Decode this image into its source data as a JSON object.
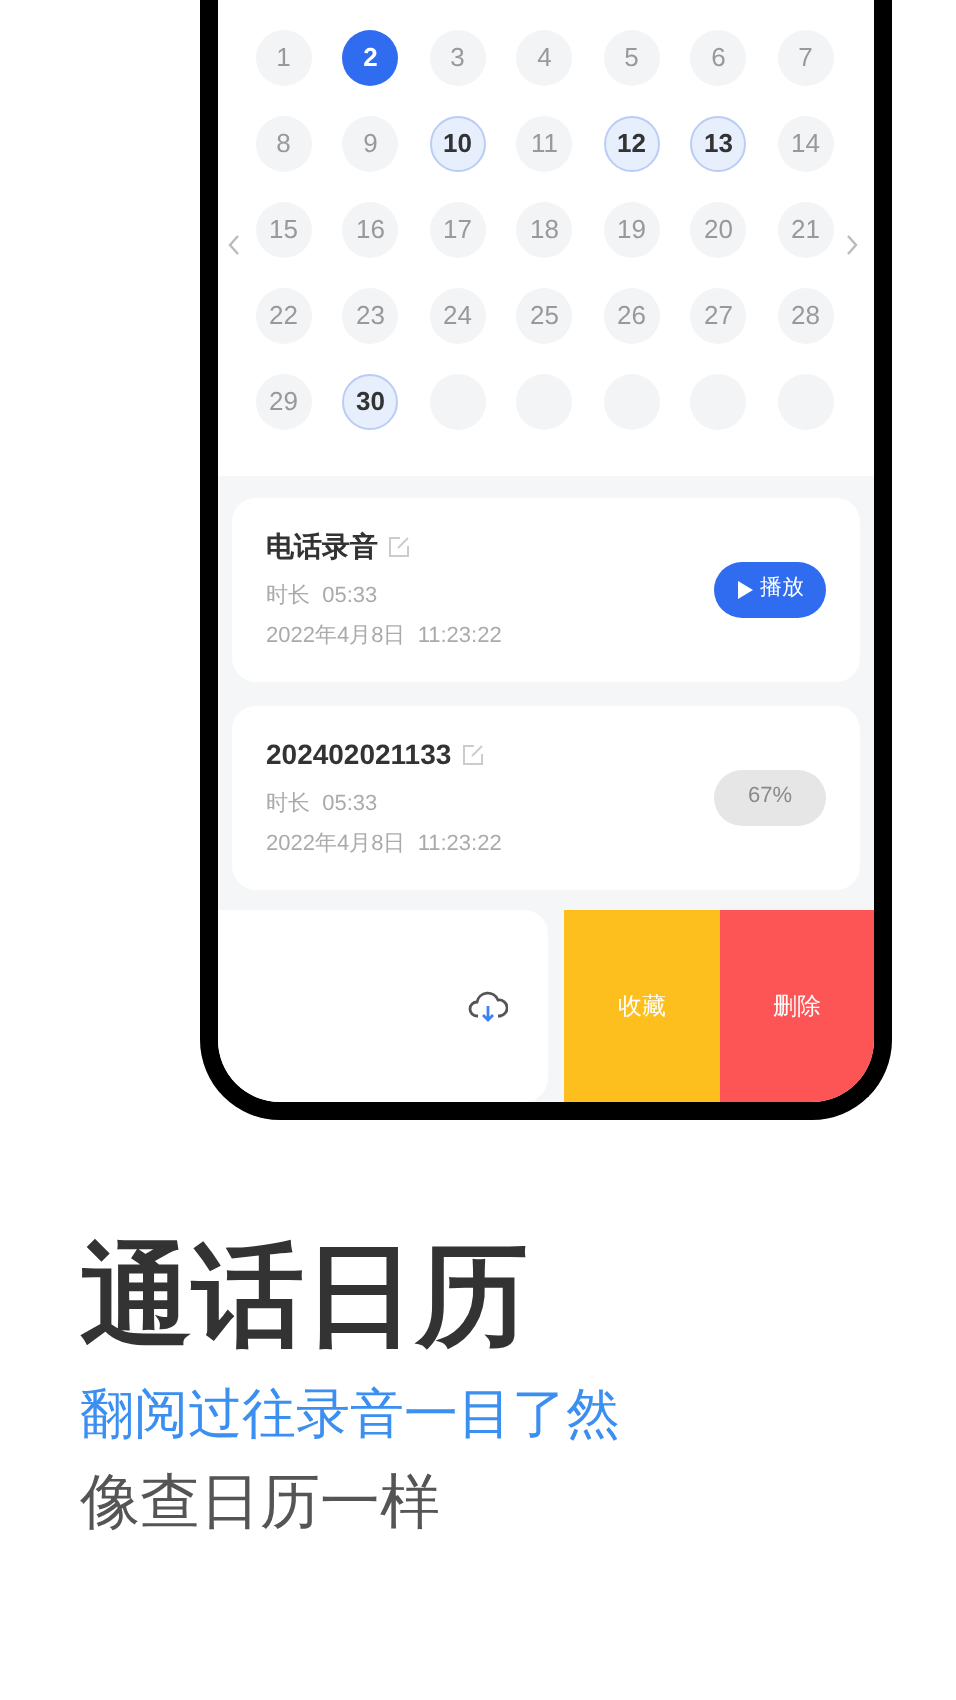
{
  "calendar": {
    "days": [
      {
        "label": "1",
        "kind": "day",
        "selected": false,
        "has_record": false
      },
      {
        "label": "2",
        "kind": "day",
        "selected": true,
        "has_record": false
      },
      {
        "label": "3",
        "kind": "day",
        "selected": false,
        "has_record": false
      },
      {
        "label": "4",
        "kind": "day",
        "selected": false,
        "has_record": false
      },
      {
        "label": "5",
        "kind": "day",
        "selected": false,
        "has_record": false
      },
      {
        "label": "6",
        "kind": "day",
        "selected": false,
        "has_record": false
      },
      {
        "label": "7",
        "kind": "day",
        "selected": false,
        "has_record": false
      },
      {
        "label": "8",
        "kind": "day",
        "selected": false,
        "has_record": false
      },
      {
        "label": "9",
        "kind": "day",
        "selected": false,
        "has_record": false
      },
      {
        "label": "10",
        "kind": "day",
        "selected": false,
        "has_record": true
      },
      {
        "label": "11",
        "kind": "day",
        "selected": false,
        "has_record": false
      },
      {
        "label": "12",
        "kind": "day",
        "selected": false,
        "has_record": true
      },
      {
        "label": "13",
        "kind": "day",
        "selected": false,
        "has_record": true
      },
      {
        "label": "14",
        "kind": "day",
        "selected": false,
        "has_record": false
      },
      {
        "label": "15",
        "kind": "day",
        "selected": false,
        "has_record": false
      },
      {
        "label": "16",
        "kind": "day",
        "selected": false,
        "has_record": false
      },
      {
        "label": "17",
        "kind": "day",
        "selected": false,
        "has_record": false
      },
      {
        "label": "18",
        "kind": "day",
        "selected": false,
        "has_record": false
      },
      {
        "label": "19",
        "kind": "day",
        "selected": false,
        "has_record": false
      },
      {
        "label": "20",
        "kind": "day",
        "selected": false,
        "has_record": false
      },
      {
        "label": "21",
        "kind": "day",
        "selected": false,
        "has_record": false
      },
      {
        "label": "22",
        "kind": "day",
        "selected": false,
        "has_record": false
      },
      {
        "label": "23",
        "kind": "day",
        "selected": false,
        "has_record": false
      },
      {
        "label": "24",
        "kind": "day",
        "selected": false,
        "has_record": false
      },
      {
        "label": "25",
        "kind": "day",
        "selected": false,
        "has_record": false
      },
      {
        "label": "26",
        "kind": "day",
        "selected": false,
        "has_record": false
      },
      {
        "label": "27",
        "kind": "day",
        "selected": false,
        "has_record": false
      },
      {
        "label": "28",
        "kind": "day",
        "selected": false,
        "has_record": false
      },
      {
        "label": "29",
        "kind": "day",
        "selected": false,
        "has_record": false
      },
      {
        "label": "30",
        "kind": "day",
        "selected": false,
        "has_record": true
      },
      {
        "kind": "blank"
      },
      {
        "kind": "blank"
      },
      {
        "kind": "blank"
      },
      {
        "kind": "blank"
      },
      {
        "kind": "blank"
      }
    ]
  },
  "recordings": [
    {
      "title": "电话录音",
      "duration": "时长  05:33",
      "date": "2022年4月8日  11:23:22",
      "action": {
        "kind": "play",
        "label": "播放"
      }
    },
    {
      "title": "202402021133",
      "duration": "时长  05:33",
      "date": "2022年4月8日  11:23:22",
      "action": {
        "kind": "progress",
        "label": "67%"
      }
    }
  ],
  "swipe_actions": [
    {
      "label": "收藏",
      "color": "#fcbf1e"
    },
    {
      "label": "删除",
      "color": "#fd5556"
    }
  ],
  "headline": "通话日历",
  "subtitle": "翻阅过往录音一目了然",
  "tagline": "像查日历一样"
}
